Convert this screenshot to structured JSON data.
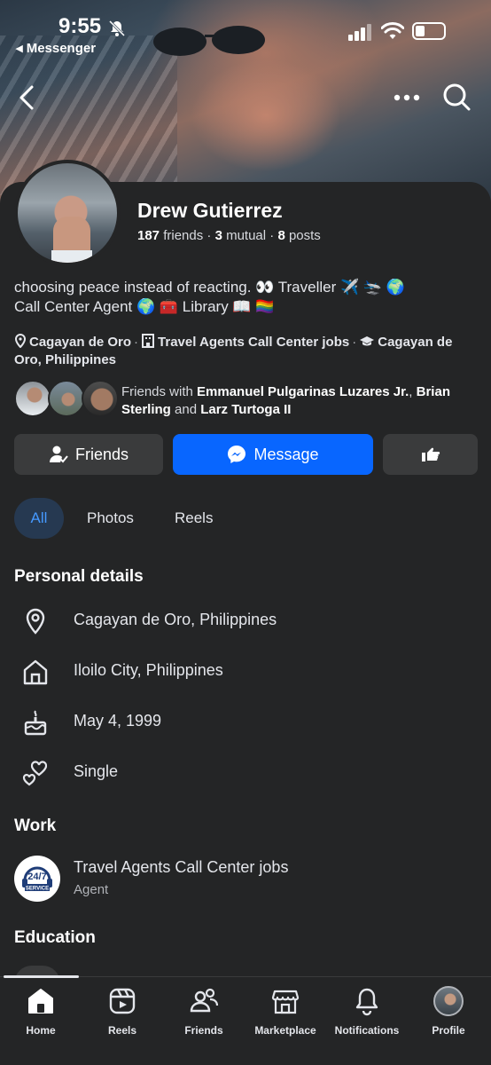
{
  "status_bar": {
    "time": "9:55",
    "back_app": "◂ Messenger"
  },
  "profile": {
    "name": "Drew Gutierrez",
    "friends_count": "187",
    "friends_label": " friends · ",
    "mutual_count": "3",
    "mutual_label": " mutual · ",
    "posts_count": "8",
    "posts_label": " posts",
    "bio_line1": "choosing peace instead of reacting. 👀 Traveller ✈️ 🛬 🌍",
    "bio_line2": "Call Center Agent 🌍 🧰 Library 📖 🏳️‍🌈"
  },
  "meta": {
    "location": "Cagayan de Oro",
    "work": "Travel Agents Call Center jobs",
    "school": "Cagayan de Oro, Philippines"
  },
  "mutual_friends": {
    "prefix": "Friends with ",
    "name1": "Emmanuel Pulgarinas Luzares Jr.",
    "sep1": ", ",
    "name2": "Brian Sterling",
    "sep2": " and ",
    "name3": "Larz Turtoga II"
  },
  "actions": {
    "friends": "Friends",
    "message": "Message"
  },
  "tabs": {
    "all": "All",
    "photos": "Photos",
    "reels": "Reels"
  },
  "personal_details": {
    "title": "Personal details",
    "current_city": "Cagayan de Oro, Philippines",
    "hometown": "Iloilo City, Philippines",
    "birthday": "May 4, 1999",
    "relationship": "Single"
  },
  "work": {
    "title": "Work",
    "employer": "Travel Agents Call Center jobs",
    "role": "Agent",
    "logo_text_1": "24/7",
    "logo_text_2": "SERVICE"
  },
  "education": {
    "title": "Education"
  },
  "tabbar": {
    "home": "Home",
    "reels": "Reels",
    "friends": "Friends",
    "marketplace": "Marketplace",
    "notifications": "Notifications",
    "profile": "Profile"
  },
  "colors": {
    "background": "#242526",
    "primary": "#0866ff",
    "secondary_button": "#3a3b3c",
    "active_tab_bg": "#263951",
    "active_tab_text": "#4599ff"
  }
}
